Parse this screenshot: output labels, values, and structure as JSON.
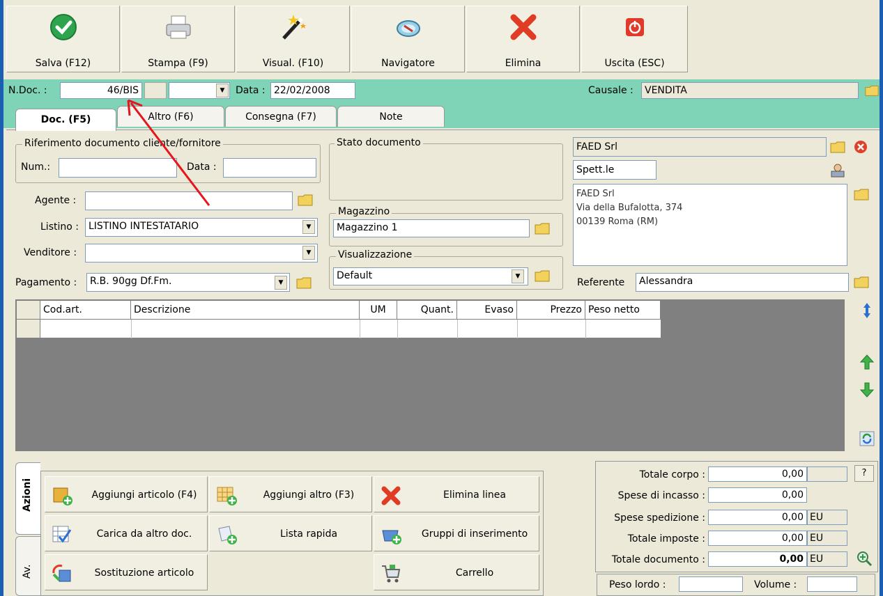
{
  "toolbar": {
    "save": "Salva (F12)",
    "print": "Stampa (F9)",
    "view": "Visual. (F10)",
    "navigator": "Navigatore",
    "delete": "Elimina",
    "exit": "Uscita (ESC)"
  },
  "header": {
    "ndoc_label": "N.Doc. :",
    "ndoc_value": "46/BIS",
    "date_label": "Data :",
    "date_value": "22/02/2008",
    "causale_label": "Causale :",
    "causale_value": "VENDITA"
  },
  "tabs": [
    "Doc. (F5)",
    "Altro (F6)",
    "Consegna (F7)",
    "Note"
  ],
  "ref": {
    "title": "Riferimento documento cliente/fornitore",
    "num_label": "Num.:",
    "num_value": "",
    "data_label": "Data :",
    "data_value": ""
  },
  "stato_title": "Stato documento",
  "agente_label": "Agente :",
  "agente_value": "",
  "listino_label": "Listino :",
  "listino_value": "LISTINO INTESTATARIO",
  "venditore_label": "Venditore :",
  "venditore_value": "",
  "pagamento_label": "Pagamento :",
  "pagamento_value": "R.B. 90gg Df.Fm.",
  "magazzino_title": "Magazzino",
  "magazzino_value": "Magazzino 1",
  "visual_title": "Visualizzazione",
  "visual_value": "Default",
  "customer": {
    "name": "FAED Srl",
    "salutation": "Spett.le",
    "address_lines": [
      "FAED Srl",
      "Via della Bufalotta, 374",
      "00139 Roma (RM)"
    ],
    "referente_label": "Referente",
    "referente_value": "Alessandra"
  },
  "grid_columns": [
    "Cod.art.",
    "Descrizione",
    "UM",
    "Quant.",
    "Evaso",
    "Prezzo",
    "Peso netto"
  ],
  "side_tabs": [
    "Azioni",
    "Av."
  ],
  "actions": [
    "Aggiungi articolo (F4)",
    "Aggiungi altro (F3)",
    "Elimina linea",
    "Carica da altro doc.",
    "Lista rapida",
    "Gruppi di inserimento",
    "Sostituzione articolo",
    "Carrello"
  ],
  "totals": {
    "corpo_label": "Totale corpo :",
    "corpo_value": "0,00",
    "incasso_label": "Spese di incasso :",
    "incasso_value": "0,00",
    "spedizione_label": "Spese spedizione :",
    "spedizione_value": "0,00",
    "imposte_label": "Totale imposte :",
    "imposte_value": "0,00",
    "documento_label": "Totale documento :",
    "documento_value": "0,00",
    "currency": "EU",
    "help": "?",
    "peso_label": "Peso lordo :",
    "volume_label": "Volume :"
  }
}
